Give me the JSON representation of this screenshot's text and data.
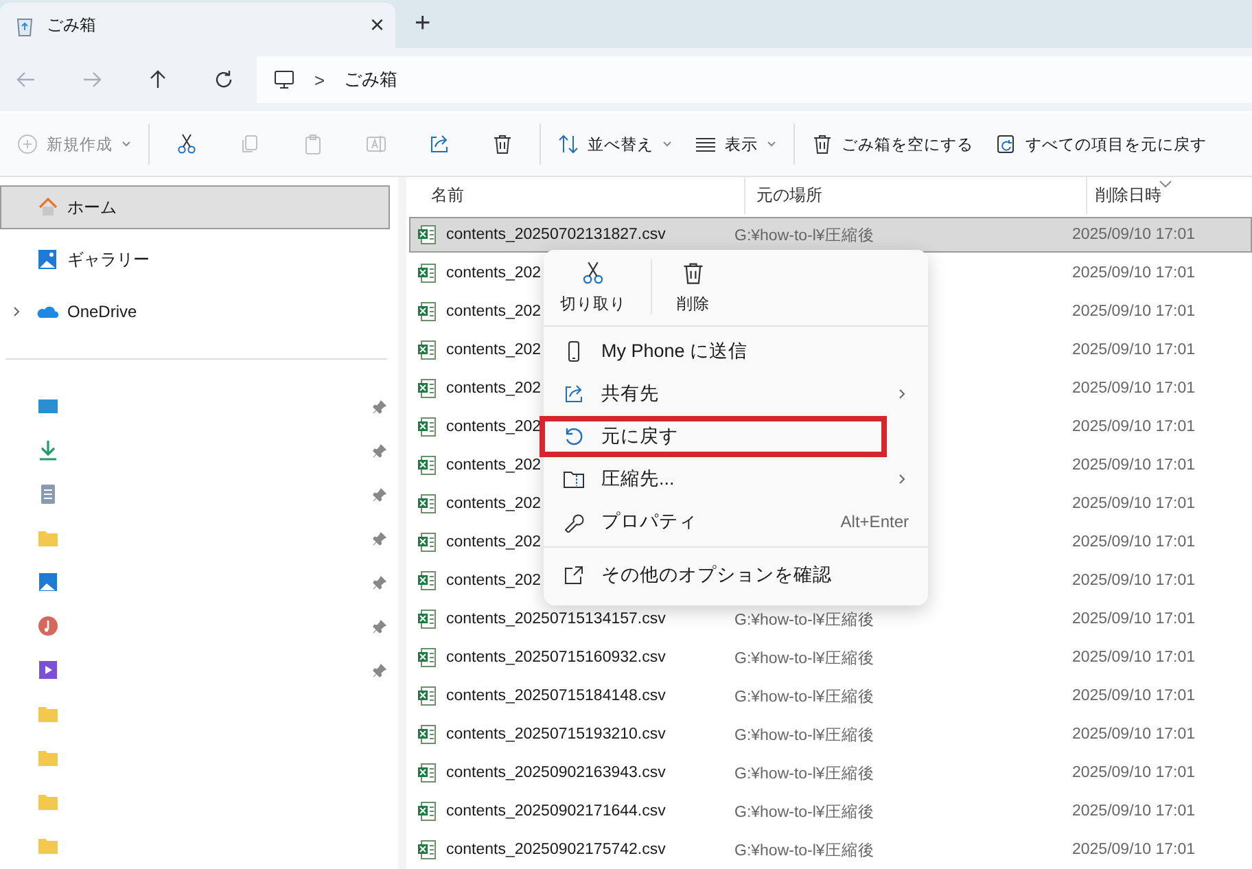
{
  "tab": {
    "title": "ごみ箱",
    "close": "×",
    "new_tab": "+"
  },
  "nav": {
    "back_disabled": true,
    "forward_disabled": true,
    "separator": ">",
    "location": "ごみ箱"
  },
  "toolbar": [
    {
      "kind": "new",
      "label": "新規作成",
      "disabled": true
    },
    {
      "kind": "cut",
      "disabled": false
    },
    {
      "kind": "copy",
      "disabled": true
    },
    {
      "kind": "paste",
      "disabled": true
    },
    {
      "kind": "rename",
      "disabled": true
    },
    {
      "kind": "share",
      "disabled": false
    },
    {
      "kind": "delete",
      "disabled": false
    },
    {
      "kind": "sort",
      "label": "並べ替え",
      "disabled": false
    },
    {
      "kind": "view",
      "label": "表示",
      "disabled": false
    },
    {
      "kind": "empty",
      "label": "ごみ箱を空にする",
      "disabled": false
    },
    {
      "kind": "restore_all",
      "label": "すべての項目を元に戻す",
      "disabled": false
    }
  ],
  "sidebar": {
    "items": [
      {
        "kind": "home",
        "label": "ホーム",
        "selected": true
      },
      {
        "kind": "gallery",
        "label": "ギャラリー",
        "selected": false
      },
      {
        "kind": "onedrive",
        "label": "OneDrive",
        "selected": false,
        "expanded": false
      }
    ],
    "quick_access": [
      {
        "kind": "desktop",
        "pinned": true
      },
      {
        "kind": "download",
        "pinned": true
      },
      {
        "kind": "document",
        "pinned": true
      },
      {
        "kind": "folder",
        "pinned": true
      },
      {
        "kind": "pictures",
        "pinned": true
      },
      {
        "kind": "music",
        "pinned": true
      },
      {
        "kind": "videos",
        "pinned": true
      },
      {
        "kind": "folder",
        "pinned": false
      },
      {
        "kind": "folder",
        "pinned": false
      },
      {
        "kind": "folder",
        "pinned": false
      },
      {
        "kind": "folder",
        "pinned": false
      }
    ]
  },
  "table": {
    "columns": [
      "名前",
      "元の場所",
      "削除日時"
    ],
    "rows": [
      {
        "name": "contents_20250702131827.csv",
        "location": "G:¥how-to-l¥圧縮後",
        "deleted": "2025/09/10 17:01",
        "selected": true
      },
      {
        "name": "contents_202",
        "deleted": "2025/09/10 17:01",
        "selected": false
      },
      {
        "name": "contents_202",
        "deleted": "2025/09/10 17:01",
        "selected": false
      },
      {
        "name": "contents_202",
        "deleted": "2025/09/10 17:01",
        "selected": false
      },
      {
        "name": "contents_202",
        "deleted": "2025/09/10 17:01",
        "selected": false
      },
      {
        "name": "contents_202",
        "deleted": "2025/09/10 17:01",
        "selected": false
      },
      {
        "name": "contents_202",
        "deleted": "2025/09/10 17:01",
        "selected": false
      },
      {
        "name": "contents_202",
        "deleted": "2025/09/10 17:01",
        "selected": false
      },
      {
        "name": "contents_202",
        "deleted": "2025/09/10 17:01",
        "selected": false
      },
      {
        "name": "contents_202",
        "deleted": "2025/09/10 17:01",
        "selected": false
      },
      {
        "name": "contents_20250715134157.csv",
        "location": "G:¥how-to-l¥圧縮後",
        "deleted": "2025/09/10 17:01",
        "selected": false
      },
      {
        "name": "contents_20250715160932.csv",
        "location": "G:¥how-to-l¥圧縮後",
        "deleted": "2025/09/10 17:01",
        "selected": false
      },
      {
        "name": "contents_20250715184148.csv",
        "location": "G:¥how-to-l¥圧縮後",
        "deleted": "2025/09/10 17:01",
        "selected": false
      },
      {
        "name": "contents_20250715193210.csv",
        "location": "G:¥how-to-l¥圧縮後",
        "deleted": "2025/09/10 17:01",
        "selected": false
      },
      {
        "name": "contents_20250902163943.csv",
        "location": "G:¥how-to-l¥圧縮後",
        "deleted": "2025/09/10 17:01",
        "selected": false
      },
      {
        "name": "contents_20250902171644.csv",
        "location": "G:¥how-to-l¥圧縮後",
        "deleted": "2025/09/10 17:01",
        "selected": false
      },
      {
        "name": "contents_20250902175742.csv",
        "location": "G:¥how-to-l¥圧縮後",
        "deleted": "2025/09/10 17:01",
        "selected": false
      }
    ]
  },
  "context_menu": {
    "top_actions": [
      {
        "kind": "cut",
        "label": "切り取り"
      },
      {
        "kind": "delete",
        "label": "削除"
      }
    ],
    "items": [
      {
        "kind": "phone",
        "label": "My Phone に送信",
        "submenu": false,
        "highlighted": false
      },
      {
        "kind": "share",
        "label": "共有先",
        "submenu": true,
        "highlighted": false
      },
      {
        "kind": "restore",
        "label": "元に戻す",
        "submenu": false,
        "highlighted": true
      },
      {
        "kind": "zip",
        "label": "圧縮先...",
        "submenu": true,
        "highlighted": false
      },
      {
        "kind": "properties",
        "label": "プロパティ",
        "shortcut": "Alt+Enter",
        "submenu": false,
        "highlighted": false
      },
      {
        "kind": "more",
        "label": "その他のオプションを確認",
        "submenu": false,
        "highlighted": false,
        "separator_before": true
      }
    ]
  }
}
